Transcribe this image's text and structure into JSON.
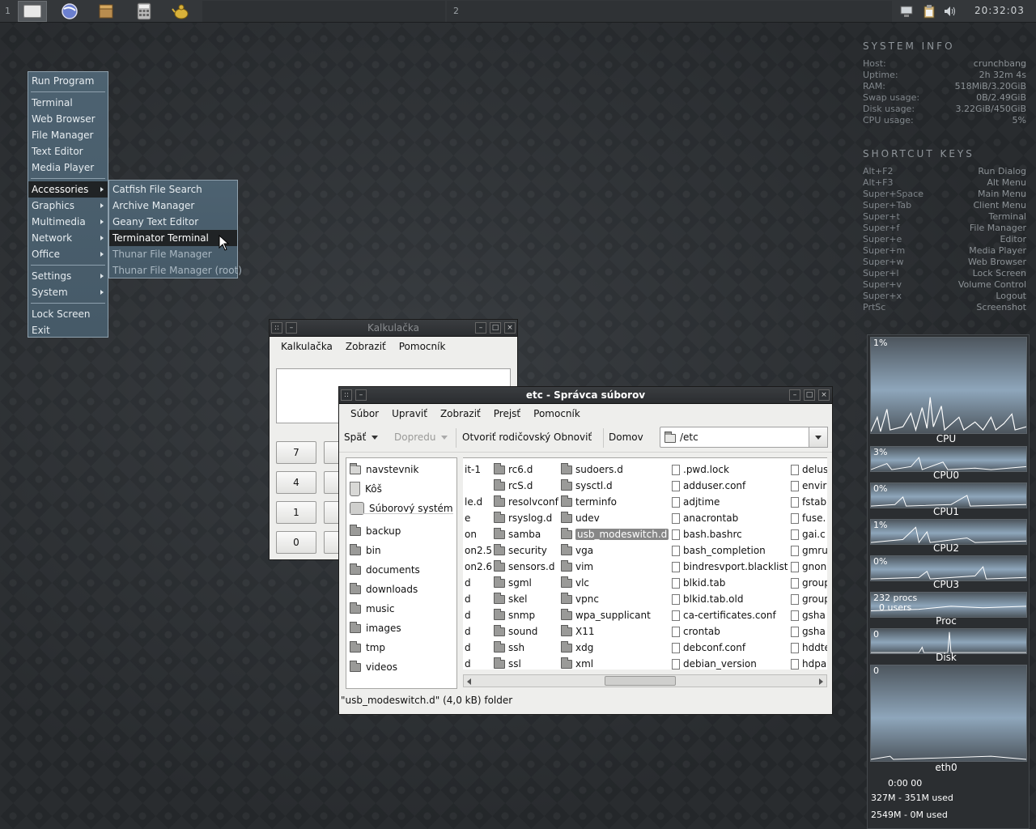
{
  "panel": {
    "ws1": "1",
    "ws2": "2",
    "clock": "20:32:03"
  },
  "conky": {
    "sysinfo_title": "SYSTEM INFO",
    "sysinfo": [
      {
        "k": "Host:",
        "v": "crunchbang"
      },
      {
        "k": "Uptime:",
        "v": "2h 32m 4s"
      },
      {
        "k": "RAM:",
        "v": "518MiB/3.20GiB"
      },
      {
        "k": "Swap usage:",
        "v": "0B/2.49GiB"
      },
      {
        "k": "Disk usage:",
        "v": "3.22GiB/450GiB"
      },
      {
        "k": "CPU usage:",
        "v": "5%"
      }
    ],
    "shortcuts_title": "SHORTCUT KEYS",
    "shortcuts": [
      {
        "k": "Alt+F2",
        "v": "Run Dialog"
      },
      {
        "k": "Alt+F3",
        "v": "Alt Menu"
      },
      {
        "k": "Super+Space",
        "v": "Main Menu"
      },
      {
        "k": "Super+Tab",
        "v": "Client Menu"
      },
      {
        "k": "Super+t",
        "v": "Terminal"
      },
      {
        "k": "Super+f",
        "v": "File Manager"
      },
      {
        "k": "Super+e",
        "v": "Editor"
      },
      {
        "k": "Super+m",
        "v": "Media Player"
      },
      {
        "k": "Super+w",
        "v": "Web Browser"
      },
      {
        "k": "Super+l",
        "v": "Lock Screen"
      },
      {
        "k": "Super+v",
        "v": "Volume Control"
      },
      {
        "k": "Super+x",
        "v": "Logout"
      },
      {
        "k": "PrtSc",
        "v": "Screenshot"
      }
    ]
  },
  "graphs": {
    "cpu": {
      "val": "1%",
      "label": "CPU"
    },
    "cpu0": {
      "val": "3%",
      "label": "CPU0"
    },
    "cpu1": {
      "val": "0%",
      "label": "CPU1"
    },
    "cpu2": {
      "val": "1%",
      "label": "CPU2"
    },
    "cpu3": {
      "val": "0%",
      "label": "CPU3"
    },
    "proc": {
      "val": "232 procs",
      "val2": "0 users",
      "label": "Proc"
    },
    "disk": {
      "val": "0",
      "label": "Disk"
    },
    "eth0": {
      "val": "0",
      "label": "eth0"
    },
    "time": "0:00 00",
    "mem1": "327M - 351M used",
    "mem2": "2549M - 0M used"
  },
  "menu": {
    "run": "Run Program",
    "terminal": "Terminal",
    "browser": "Web Browser",
    "filemgr": "File Manager",
    "editor": "Text Editor",
    "media": "Media Player",
    "accessories": "Accessories",
    "graphics": "Graphics",
    "multimedia": "Multimedia",
    "network": "Network",
    "office": "Office",
    "settings": "Settings",
    "system": "System",
    "lock": "Lock Screen",
    "exit": "Exit"
  },
  "submenu": {
    "catfish": "Catfish File Search",
    "archive": "Archive Manager",
    "geany": "Geany Text Editor",
    "terminator": "Terminator Terminal",
    "thunar": "Thunar File Manager",
    "thunar_root": "Thunar File Manager (root)"
  },
  "calc": {
    "title": "Kalkulačka",
    "menu": [
      "Kalkulačka",
      "Zobraziť",
      "Pomocník"
    ],
    "keys": [
      "7",
      "4",
      "1",
      "0"
    ]
  },
  "fm": {
    "title": "etc - Správca súborov",
    "menu": [
      "Súbor",
      "Upraviť",
      "Zobraziť",
      "Prejsť",
      "Pomocník"
    ],
    "back": "Späť",
    "forward": "Dopredu",
    "parent": "Otvoriť rodičovský",
    "refresh": "Obnoviť",
    "home": "Domov",
    "path": "/etc",
    "sidebar": [
      "navstevnik",
      "Kôš",
      "Súborový systém",
      "backup",
      "bin",
      "documents",
      "downloads",
      "music",
      "images",
      "tmp",
      "videos"
    ],
    "col0": [
      "it-1",
      "",
      "le.d",
      "e",
      "on",
      "on2.5",
      "on2.6",
      "d",
      "d",
      "d",
      "d",
      "d",
      "d"
    ],
    "col1": [
      "rc6.d",
      "rcS.d",
      "resolvconf",
      "rsyslog.d",
      "samba",
      "security",
      "sensors.d",
      "sgml",
      "skel",
      "snmp",
      "sound",
      "ssh",
      "ssl"
    ],
    "col2": [
      "sudoers.d",
      "sysctl.d",
      "terminfo",
      "udev",
      "usb_modeswitch.d",
      "vga",
      "vim",
      "vlc",
      "vpnc",
      "wpa_supplicant",
      "X11",
      "xdg",
      "xml"
    ],
    "col3": [
      ".pwd.lock",
      "adduser.conf",
      "adjtime",
      "anacrontab",
      "bash.bashrc",
      "bash_completion",
      "bindresvport.blacklist",
      "blkid.tab",
      "blkid.tab.old",
      "ca-certificates.conf",
      "crontab",
      "debconf.conf",
      "debian_version"
    ],
    "col4": [
      "delus",
      "envir",
      "fstab",
      "fuse.",
      "gai.c",
      "gmru",
      "gnon",
      "group",
      "group",
      "gsha",
      "gsha",
      "hddte",
      "hdpa"
    ],
    "status": "\"usb_modeswitch.d\" (4,0 kB) folder"
  }
}
